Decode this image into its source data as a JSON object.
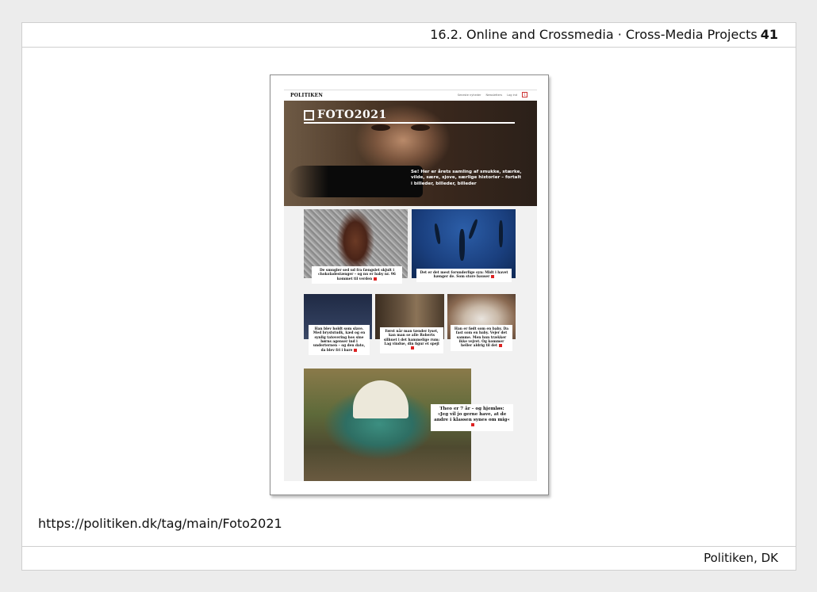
{
  "header": {
    "section": "16.2. Online and Crossmedia · Cross-Media Projects",
    "page_number": "41"
  },
  "footer": {
    "source": "Politiken, DK"
  },
  "url": "https://politiken.dk/tag/main/Foto2021",
  "screenshot": {
    "site_logo": "POLITIKEN",
    "nav": [
      "Seneste nyheder",
      "Newsletters",
      "Log ind",
      "1"
    ],
    "hero": {
      "logo": "FOTO2021",
      "text": "Se! Her er årets samling af smukke, stærke, vilde, sære, sjove, særlige historier – fortalt i billeder, billeder, billeder"
    },
    "tiles": [
      {
        "caption": "De smugler sed ud fra fængslet skjult i chokoladestænger – og nu er baby nr. 96 kommet til verden"
      },
      {
        "caption": "Det er det mest forunderlige syn: Midt i havet hænger de. Som store bauser"
      },
      {
        "caption": "Han blev holdt som slave. Med bryststudk, kæd og en synlig tatovering hos sine børns agenser ind i underternen – og den dato, da blev fri i bare"
      },
      {
        "caption": "Først når man tænder lyset, kan man se alle Roberts silhuet i det hammelige rum: Lag vindue, din figur et spejl"
      },
      {
        "caption": "Han er født som en baby. Da fast som en baby. Vejer det samme. Men hun trækker ikke vejret. Og kommer heller aldrig til det"
      },
      {
        "caption": "Theo er 7 år – og hjemløs: »Jeg vil jo gerne have, at de andre i klassen synes om mig«"
      }
    ]
  }
}
